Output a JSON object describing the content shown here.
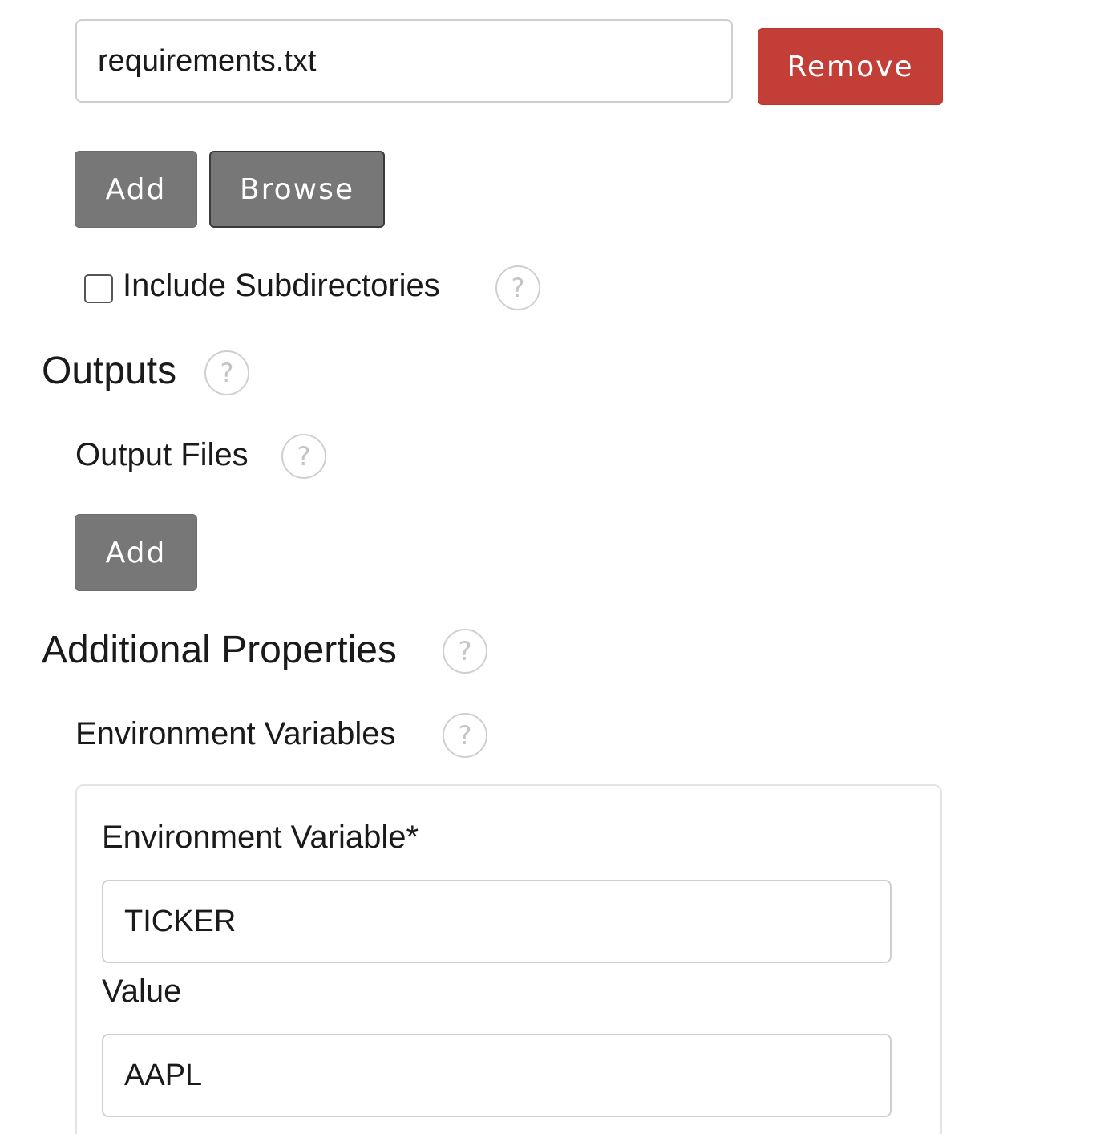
{
  "inputs_section": {
    "file_entry": {
      "value": "requirements.txt",
      "remove_label": "Remove"
    },
    "add_label": "Add",
    "browse_label": "Browse",
    "include_subdirectories": {
      "label": "Include Subdirectories",
      "checked": false,
      "help": "?"
    }
  },
  "outputs": {
    "title": "Outputs",
    "help": "?",
    "output_files": {
      "label": "Output Files",
      "help": "?",
      "add_label": "Add"
    }
  },
  "additional_properties": {
    "title": "Additional Properties",
    "help": "?",
    "environment_variables": {
      "label": "Environment Variables",
      "help": "?",
      "entry": {
        "name_label": "Environment Variable*",
        "name_value": "TICKER",
        "value_label": "Value",
        "value_value": "AAPL"
      }
    }
  },
  "colors": {
    "danger": "#c33e37",
    "neutral_button": "#777777"
  }
}
